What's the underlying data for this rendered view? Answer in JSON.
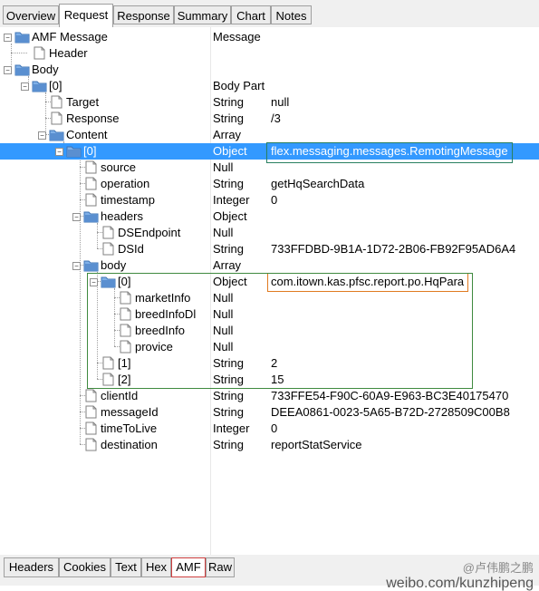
{
  "top_tabs": [
    "Overview",
    "Request",
    "Response",
    "Summary",
    "Chart",
    "Notes"
  ],
  "bottom_tabs": [
    "Headers",
    "Cookies",
    "Text",
    "Hex",
    "AMF",
    "Raw"
  ],
  "tree": [
    {
      "name": "AMF Message",
      "type": "Message",
      "value": ""
    },
    {
      "name": "Header",
      "type": "",
      "value": ""
    },
    {
      "name": "Body",
      "type": "",
      "value": ""
    },
    {
      "name": "[0]",
      "type": "Body Part",
      "value": ""
    },
    {
      "name": "Target",
      "type": "String",
      "value": "null"
    },
    {
      "name": "Response",
      "type": "String",
      "value": "/3"
    },
    {
      "name": "Content",
      "type": "Array",
      "value": ""
    },
    {
      "name": "[0]",
      "type": "Object",
      "value": "flex.messaging.messages.RemotingMessage"
    },
    {
      "name": "source",
      "type": "Null",
      "value": ""
    },
    {
      "name": "operation",
      "type": "String",
      "value": "getHqSearchData"
    },
    {
      "name": "timestamp",
      "type": "Integer",
      "value": "0"
    },
    {
      "name": "headers",
      "type": "Object",
      "value": ""
    },
    {
      "name": "DSEndpoint",
      "type": "Null",
      "value": ""
    },
    {
      "name": "DSId",
      "type": "String",
      "value": "733FFDBD-9B1A-1D72-2B06-FB92F95AD6A4"
    },
    {
      "name": "body",
      "type": "Array",
      "value": ""
    },
    {
      "name": "[0]",
      "type": "Object",
      "value": "com.itown.kas.pfsc.report.po.HqPara"
    },
    {
      "name": "marketInfo",
      "type": "Null",
      "value": ""
    },
    {
      "name": "breedInfoDl",
      "type": "Null",
      "value": ""
    },
    {
      "name": "breedInfo",
      "type": "Null",
      "value": ""
    },
    {
      "name": "provice",
      "type": "Null",
      "value": ""
    },
    {
      "name": "[1]",
      "type": "String",
      "value": "2"
    },
    {
      "name": "[2]",
      "type": "String",
      "value": "15"
    },
    {
      "name": "clientId",
      "type": "String",
      "value": "733FFE54-F90C-60A9-E963-BC3E40175470"
    },
    {
      "name": "messageId",
      "type": "String",
      "value": "DEEA0861-0023-5A65-B72D-2728509C00B8"
    },
    {
      "name": "timeToLive",
      "type": "Integer",
      "value": "0"
    },
    {
      "name": "destination",
      "type": "String",
      "value": "reportStatService"
    }
  ],
  "watermark": {
    "handle": "@卢伟鹏之鹏",
    "url": "weibo.com/kunzhipeng"
  },
  "colors": {
    "selection": "#3399ff",
    "orange_box": "#e07a20",
    "green_box": "#3f8a3f",
    "folder": "#5a8fd0"
  }
}
